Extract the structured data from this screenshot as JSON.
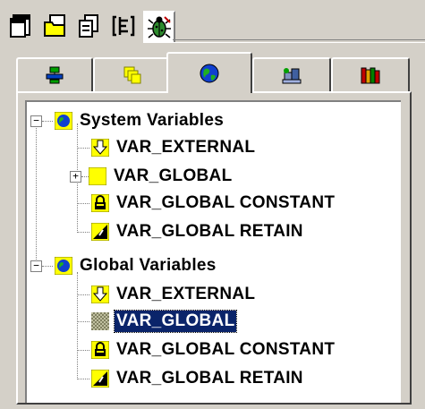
{
  "toolbar": {
    "buttons": [
      {
        "icon": "window-cascade-icon"
      },
      {
        "icon": "folder-window-icon"
      },
      {
        "icon": "copy-window-icon"
      },
      {
        "icon": "brackets-icon"
      },
      {
        "icon": "bug-icon",
        "active": true
      }
    ]
  },
  "tabs": [
    {
      "icon": "network-icon"
    },
    {
      "icon": "stack-windows-icon"
    },
    {
      "icon": "globe-icon",
      "selected": true
    },
    {
      "icon": "blocks-icon"
    },
    {
      "icon": "library-books-icon"
    }
  ],
  "tree": {
    "groups": [
      {
        "label": "System Variables",
        "icon": "globe-icon",
        "items": [
          {
            "label": "VAR_EXTERNAL",
            "icon": "external-var-icon"
          },
          {
            "label": "VAR_GLOBAL",
            "icon": "global-var-icon",
            "expandable": true
          },
          {
            "label": "VAR_GLOBAL CONSTANT",
            "icon": "lock-icon"
          },
          {
            "label": "VAR_GLOBAL RETAIN",
            "icon": "retain-icon"
          }
        ]
      },
      {
        "label": "Global Variables",
        "icon": "globe-icon",
        "items": [
          {
            "label": "VAR_EXTERNAL",
            "icon": "external-var-icon"
          },
          {
            "label": "VAR_GLOBAL",
            "icon": "global-var-checkered-icon",
            "selected": true
          },
          {
            "label": "VAR_GLOBAL CONSTANT",
            "icon": "lock-icon"
          },
          {
            "label": "VAR_GLOBAL RETAIN",
            "icon": "retain-icon"
          }
        ]
      }
    ]
  },
  "colors": {
    "face": "#d4d0c8",
    "selection": "#0a246a",
    "yellow": "#ffff00"
  }
}
